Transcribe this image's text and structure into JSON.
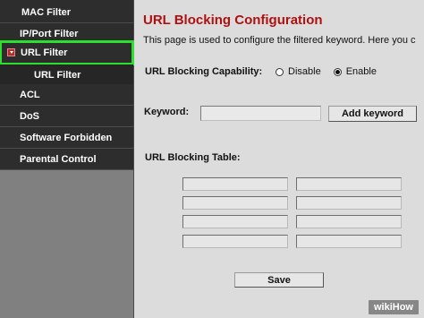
{
  "sidebar": {
    "items": [
      {
        "label": "MAC Filter",
        "state": "normal"
      },
      {
        "label": "IP/Port Filter",
        "state": "normal"
      },
      {
        "label": "URL Filter",
        "state": "active-expanded"
      },
      {
        "label": "URL Filter",
        "state": "sub-item"
      },
      {
        "label": "ACL",
        "state": "normal"
      },
      {
        "label": "DoS",
        "state": "normal"
      },
      {
        "label": "Software Forbidden",
        "state": "normal"
      },
      {
        "label": "Parental Control",
        "state": "normal"
      }
    ],
    "highlight_color": "#2ee02e",
    "bullet_color": "#b52a2a"
  },
  "main": {
    "title": "URL Blocking Configuration",
    "title_color": "#b01010",
    "description": "This page is used to configure the filtered keyword. Here you c",
    "capability": {
      "label": "URL Blocking Capability:",
      "options": [
        "Disable",
        "Enable"
      ],
      "selected": "Enable"
    },
    "keyword": {
      "label": "Keyword:",
      "value": "",
      "button": "Add keyword"
    },
    "table": {
      "label": "URL Blocking Table:",
      "rows": [
        [
          "",
          ""
        ],
        [
          "",
          ""
        ],
        [
          "",
          ""
        ],
        [
          "",
          ""
        ]
      ]
    },
    "save_button": "Save"
  },
  "watermark": {
    "part1": "wiki",
    "part2": "How"
  }
}
